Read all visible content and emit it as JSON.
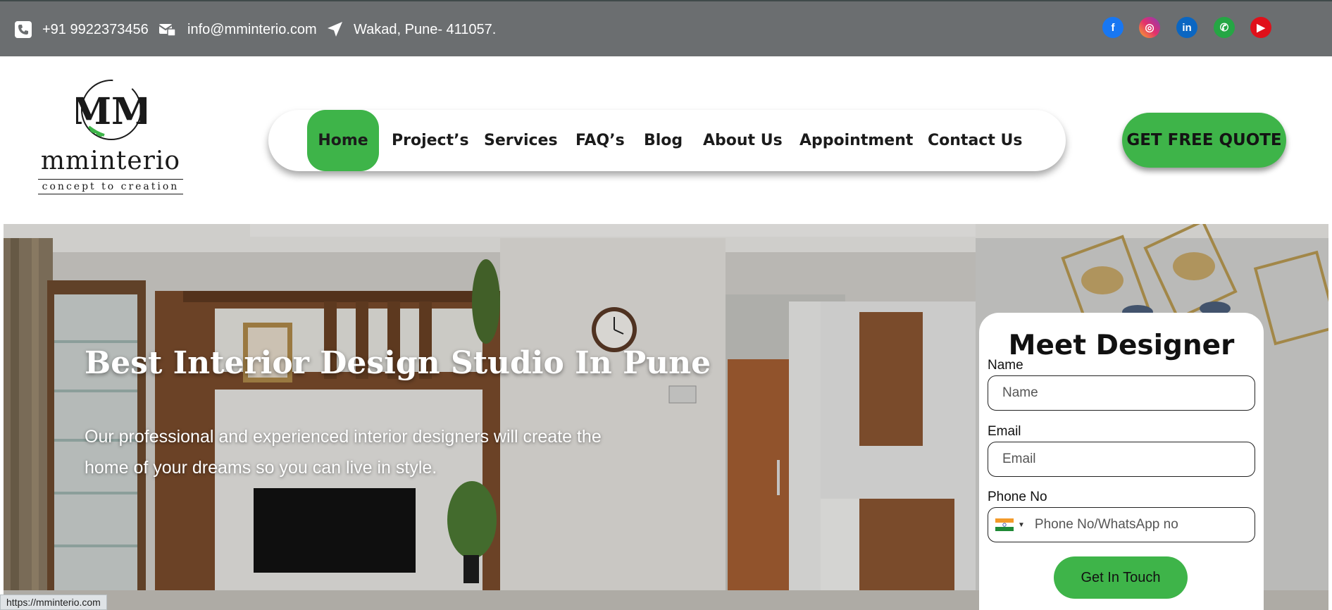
{
  "topbar": {
    "phone": "+91 9922373456",
    "email": "info@mminterio.com",
    "address": "Wakad, Pune- 411057.",
    "icons": [
      "phone-icon",
      "mail-icon",
      "location-arrow-icon"
    ],
    "social": [
      {
        "name": "facebook-icon",
        "glyph": "f"
      },
      {
        "name": "instagram-icon",
        "glyph": "◎"
      },
      {
        "name": "linkedin-icon",
        "glyph": "in"
      },
      {
        "name": "whatsapp-icon",
        "glyph": "✆"
      },
      {
        "name": "youtube-icon",
        "glyph": "▶"
      }
    ],
    "bar_color": "#6b6e70"
  },
  "logo": {
    "monogram": "MM",
    "wordmark": "mminterio",
    "tagline": "concept to creation"
  },
  "nav": {
    "items": [
      "Home",
      "Project’s",
      "Services",
      "FAQ’s",
      "Blog",
      "About Us",
      "Appointment",
      "Contact Us"
    ],
    "active": "Home",
    "cta": "GET FREE QUOTE",
    "accent": "#3eb449"
  },
  "hero": {
    "title": "Best Interior Design Studio In Pune",
    "subtitle": "Our professional and experienced interior designers will create the home of your dreams so you can live in style."
  },
  "form": {
    "title": "Meet Designer",
    "fields": [
      {
        "label": "Name",
        "placeholder": "Name"
      },
      {
        "label": "Email",
        "placeholder": "Email"
      },
      {
        "label": "Phone No",
        "placeholder": "Phone No/WhatsApp no"
      }
    ],
    "country_flag": "india-flag-icon",
    "submit": "Get In Touch"
  },
  "status_url": "https://mminterio.com"
}
